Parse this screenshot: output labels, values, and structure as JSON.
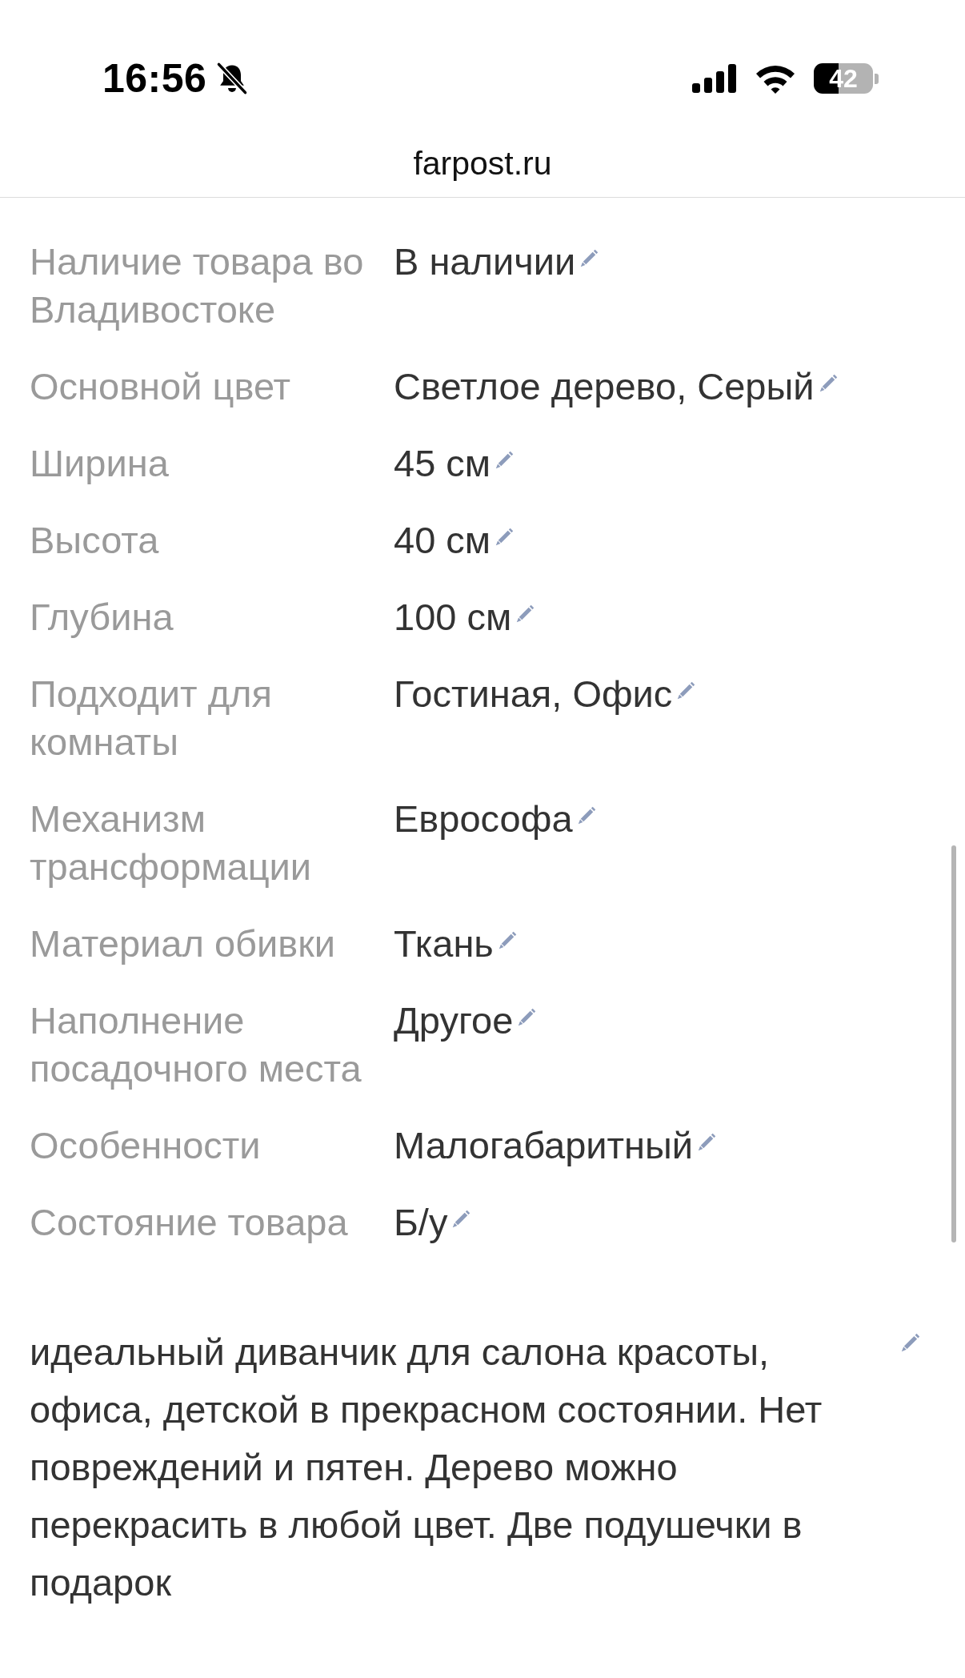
{
  "status_bar": {
    "time": "16:56",
    "silent": true,
    "battery": "42"
  },
  "address_bar": {
    "url": "farpost.ru"
  },
  "specs": [
    {
      "label": "Наличие товара во Владивостоке",
      "value": "В наличии"
    },
    {
      "label": "Основной цвет",
      "value": "Светлое дерево, Серый"
    },
    {
      "label": "Ширина",
      "value": "45 см"
    },
    {
      "label": "Высота",
      "value": "40 см"
    },
    {
      "label": "Глубина",
      "value": "100 см"
    },
    {
      "label": "Подходит для комнаты",
      "value": "Гостиная, Офис"
    },
    {
      "label": "Механизм трансформации",
      "value": "Еврософа"
    },
    {
      "label": "Материал обивки",
      "value": "Ткань"
    },
    {
      "label": "Наполнение посадочного места",
      "value": "Другое"
    },
    {
      "label": "Особенности",
      "value": "Малогабаритный"
    },
    {
      "label": "Состояние товара",
      "value": "Б/у"
    }
  ],
  "description": {
    "text": "идеальный диванчик для салона красоты, офиса, детской в прекрасном состоянии. Нет повреждений и пятен. Дерево можно перекрасить в любой цвет. Две подушечки в подарок"
  }
}
